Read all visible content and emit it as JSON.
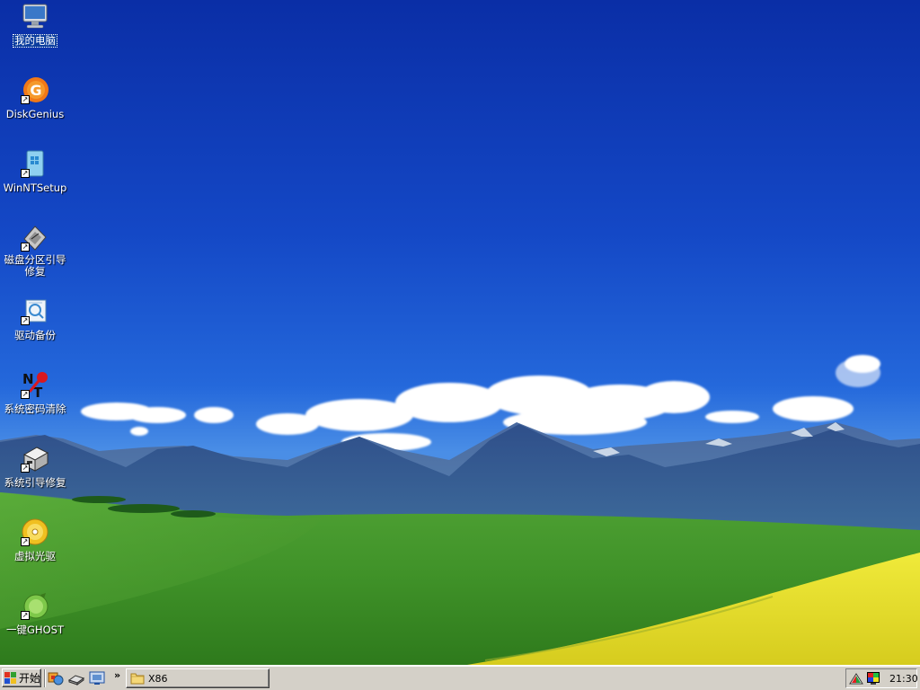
{
  "desktop": {
    "icons": [
      {
        "label": "我的电脑",
        "icon": "computer-icon",
        "shortcut": false,
        "selected": true
      },
      {
        "label": "DiskGenius",
        "icon": "diskgenius-icon",
        "shortcut": true
      },
      {
        "label": "WinNTSetup",
        "icon": "winntsetup-icon",
        "shortcut": true
      },
      {
        "label": "磁盘分区引导修复",
        "icon": "disk-repair-icon",
        "shortcut": true
      },
      {
        "label": "驱动备份",
        "icon": "driver-backup-icon",
        "shortcut": true
      },
      {
        "label": "系统密码清除",
        "icon": "password-clear-icon",
        "shortcut": true
      },
      {
        "label": "系统引导修复",
        "icon": "boot-repair-icon",
        "shortcut": true
      },
      {
        "label": "虚拟光驱",
        "icon": "virtual-drive-icon",
        "shortcut": true
      },
      {
        "label": "一键GHOST",
        "icon": "ghost-icon",
        "shortcut": true
      }
    ],
    "shortcut_glyph": "↗"
  },
  "taskbar": {
    "start_label": "开始",
    "quicklaunch": [
      "control-panel-icon",
      "drive-icon",
      "display-settings-icon"
    ],
    "chevron": "»",
    "tasks": [
      {
        "label": "X86",
        "icon": "folder-icon"
      }
    ],
    "tray": {
      "icons": [
        "network-icon",
        "color-display-icon"
      ],
      "clock": "21:30"
    }
  },
  "colors": {
    "sky_top": "#0a2fa8",
    "grass": "#4a9a2e",
    "rapeseed": "#e8e030",
    "taskbar": "#d4d0c8"
  }
}
